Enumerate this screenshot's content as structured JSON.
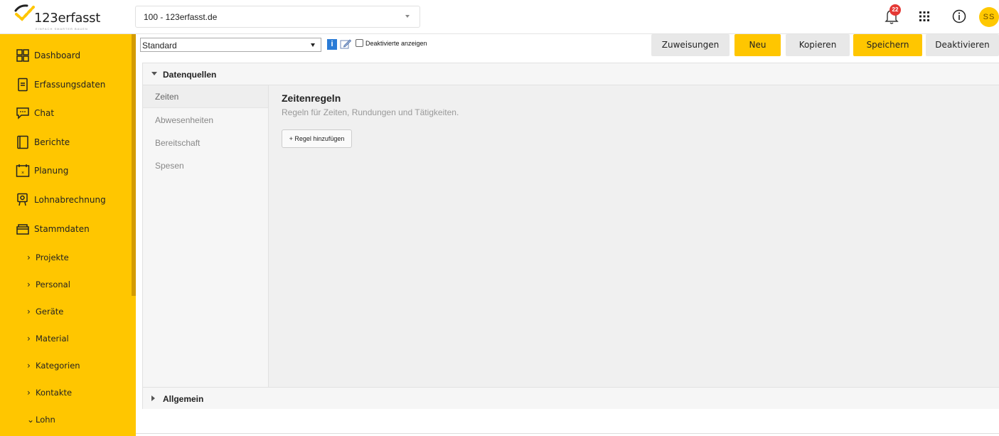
{
  "brand": {
    "name": "123erfasst",
    "tagline": "EINFACH SMARTER BAUEN",
    "accent": "#ffc600"
  },
  "header": {
    "tenant_select": "100 - 123erfasst.de",
    "notification_count": "22",
    "avatar_initials": "SS",
    "icons": [
      "bell-icon",
      "apps-grid-icon",
      "info-icon"
    ]
  },
  "sidebar": {
    "items": [
      {
        "label": "Dashboard",
        "icon": "dashboard-icon"
      },
      {
        "label": "Erfassungsdaten",
        "icon": "document-icon"
      },
      {
        "label": "Chat",
        "icon": "chat-icon"
      },
      {
        "label": "Berichte",
        "icon": "report-icon"
      },
      {
        "label": "Planung",
        "icon": "calendar-icon"
      },
      {
        "label": "Lohnabrechnung",
        "icon": "payroll-icon"
      },
      {
        "label": "Stammdaten",
        "icon": "master-data-icon"
      }
    ],
    "subitems": [
      {
        "label": "Projekte",
        "chev": "›"
      },
      {
        "label": "Personal",
        "chev": "›"
      },
      {
        "label": "Geräte",
        "chev": "›"
      },
      {
        "label": "Material",
        "chev": "›"
      },
      {
        "label": "Kategorien",
        "chev": "›"
      },
      {
        "label": "Kontakte",
        "chev": "›"
      },
      {
        "label": "Lohn",
        "chev": "⌄"
      }
    ]
  },
  "toolbar": {
    "profile_select": "Standard",
    "show_disabled_label": "Deaktivierte anzeigen",
    "buttons": {
      "assignments": "Zuweisungen",
      "new": "Neu",
      "copy": "Kopieren",
      "save": "Speichern",
      "disable": "Deaktivieren"
    }
  },
  "panel": {
    "section_datasources": "Datenquellen",
    "section_general": "Allgemein",
    "nav": [
      "Zeiten",
      "Abwesenheiten",
      "Bereitschaft",
      "Spesen"
    ],
    "active_nav": "Zeiten",
    "content": {
      "title": "Zeitenregeln",
      "subtitle": "Regeln für Zeiten, Rundungen und Tätigkeiten.",
      "add_rule_button": "+ Regel hinzufügen"
    }
  }
}
